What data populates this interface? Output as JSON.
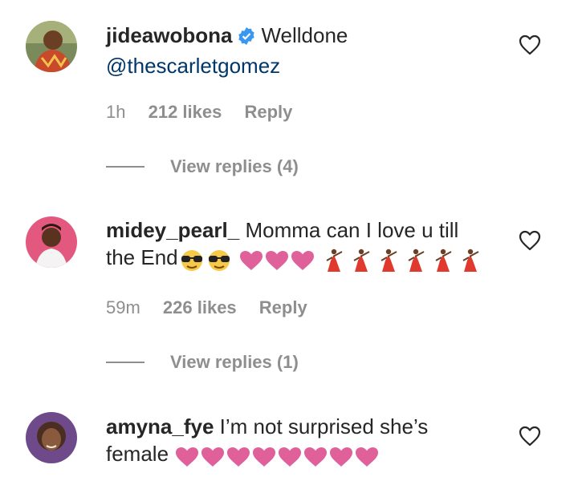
{
  "comments": [
    {
      "username": "jideawobona",
      "verified": true,
      "text_line1": "Welldone",
      "mention": "@thescarletgomez",
      "time": "1h",
      "likes": "212 likes",
      "reply": "Reply",
      "view_replies": "View replies (4)"
    },
    {
      "username": "midey_pearl_",
      "verified": false,
      "text_line1": "Momma can I love u till",
      "text_line2": "the End",
      "emoji": [
        "sunglasses-emoji",
        "sunglasses-emoji",
        "pink-heart",
        "pink-heart",
        "pink-heart",
        "dancer",
        "dancer",
        "dancer",
        "dancer",
        "dancer",
        "dancer"
      ],
      "time": "59m",
      "likes": "226 likes",
      "reply": "Reply",
      "view_replies": "View replies (1)"
    },
    {
      "username": "amyna_fye",
      "verified": false,
      "text_line1": "I’m not surprised she’s",
      "text_line2": "female",
      "emoji": [
        "pink-heart",
        "pink-heart",
        "pink-heart",
        "pink-heart",
        "pink-heart",
        "pink-heart",
        "pink-heart",
        "pink-heart"
      ]
    }
  ],
  "colors": {
    "text": "#262626",
    "muted": "#8e8e8e",
    "mention": "#00376b",
    "verified": "#3897f0",
    "heart_emoji": "#e0609a"
  }
}
